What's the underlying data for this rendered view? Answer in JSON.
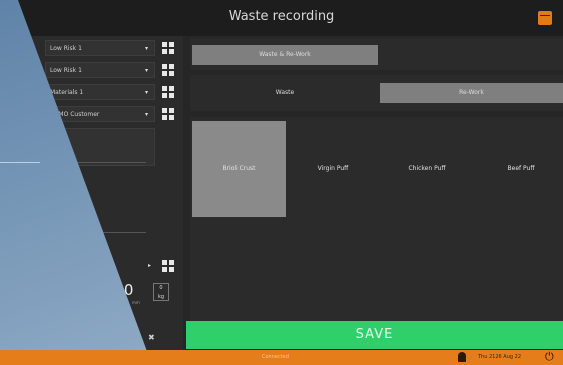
{
  "header": {
    "title": "Waste recording",
    "back_icon": "arrow-left-icon",
    "calendar_icon": "calendar-icon"
  },
  "left_panel": {
    "rows": [
      {
        "label": "",
        "value": "Low Risk 1"
      },
      {
        "label": "m",
        "value": "Low Risk 1"
      },
      {
        "label": "",
        "value": "Materials 1"
      },
      {
        "label": "",
        "value": "DEMO Customer"
      }
    ],
    "weight": "23.0",
    "weight_unit": "mm",
    "tare_top": "0",
    "tare_bottom": "kg"
  },
  "filters": {
    "category": {
      "selected": "Waste & Re-Work"
    },
    "types": [
      "Waste",
      "Re-Work"
    ],
    "selected_type": "Re-Work"
  },
  "products": [
    {
      "label": "Brioli Crust",
      "selected": true
    },
    {
      "label": "Virgin Puff",
      "selected": false
    },
    {
      "label": "Chicken Puff",
      "selected": false
    },
    {
      "label": "Beef Puff",
      "selected": false
    }
  ],
  "save_label": "SAVE",
  "status": {
    "center_text": "Connected",
    "datetime": "Thu 2126 Aug 22",
    "user_icon": "user-icon",
    "power_icon": "power-icon"
  },
  "colors": {
    "accent": "#e57d1a",
    "save": "#2fcf6a",
    "selected_tile": "#8a8a8a"
  }
}
